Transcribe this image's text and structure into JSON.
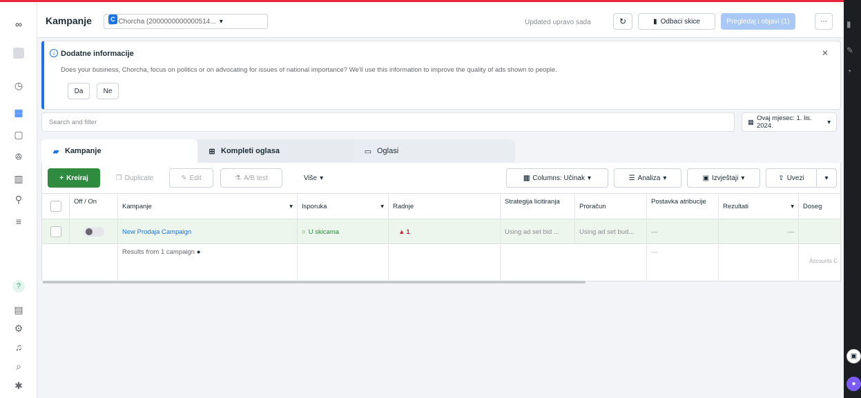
{
  "header": {
    "title": "Kampanje",
    "account_badge": "C",
    "account_name": "Chorcha (2000000000000514...",
    "updated": "Updated upravo sada",
    "discard_label": "Odbaci skice",
    "publish_label": "Pregledaj i objavi (1)"
  },
  "banner": {
    "title": "Dodatne informacije",
    "text": "Does your business, Chorcha, focus on politics or on advocating for issues of national importance? We'll use this information to improve the quality of ads shown to people.",
    "yes": "Da",
    "no": "Ne"
  },
  "search": {
    "placeholder": "Search and filter"
  },
  "date": {
    "label": "Ovaj mjesec: 1. lis. 2024."
  },
  "tabs": [
    {
      "label": "Kampanje"
    },
    {
      "label": "Kompleti oglasa"
    },
    {
      "label": "Oglasi"
    }
  ],
  "toolbar": {
    "create": "Kreiraj",
    "duplicate": "Duplicate",
    "edit": "Edit",
    "ab": "A/B test",
    "more": "Više",
    "columns": "Columns: Učinak",
    "analyze": "Analiza",
    "reports": "Izvještaji",
    "export": "Uvezi"
  },
  "table": {
    "headers": {
      "onoff": "Off / On",
      "campaign": "Kampanje",
      "delivery": "Isporuka",
      "actions": "Radnje",
      "bid": "Strategija licitiranja",
      "budget": "Proračun",
      "attribution": "Postavka atribucije",
      "results": "Rezultati",
      "reach": "Doseg"
    },
    "row": {
      "name": "New Prodaja Campaign",
      "delivery": "U skicama",
      "actions": "1",
      "bid": "Using ad set bid ...",
      "budget": "Using ad set bud...",
      "attribution": "—",
      "results": "—"
    },
    "summary": {
      "label": "Results from 1 campaign",
      "attribution": "—",
      "reach": "Accounts C"
    }
  }
}
